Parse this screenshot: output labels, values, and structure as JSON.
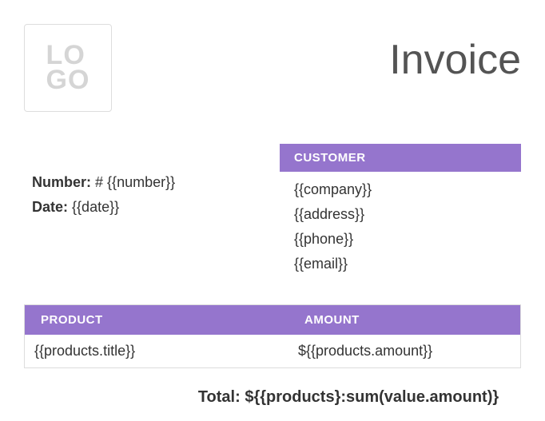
{
  "header": {
    "logo_line1": "LO",
    "logo_line2": "GO",
    "title": "Invoice"
  },
  "invoice_info": {
    "number_label": "Number:",
    "number_value": "# {{number}}",
    "date_label": "Date:",
    "date_value": "{{date}}"
  },
  "customer": {
    "header": "CUSTOMER",
    "company": "{{company}}",
    "address": "{{address}}",
    "phone": "{{phone}}",
    "email": "{{email}}"
  },
  "products_table": {
    "headers": {
      "product": "PRODUCT",
      "amount": "AMOUNT"
    },
    "row": {
      "title": "{{products.title}}",
      "amount": "${{products.amount}}"
    }
  },
  "total": {
    "label": "Total:",
    "value": "${{products}:sum(value.amount)}"
  }
}
